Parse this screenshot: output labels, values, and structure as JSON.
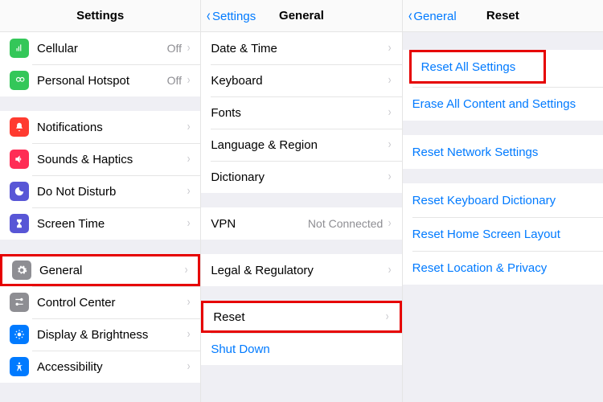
{
  "panes": {
    "settings": {
      "title": "Settings",
      "group1": [
        {
          "label": "Cellular",
          "detail": "Off",
          "icon": "antenna",
          "iconColor": "#34c759"
        },
        {
          "label": "Personal Hotspot",
          "detail": "Off",
          "icon": "link",
          "iconColor": "#34c759"
        }
      ],
      "group2": [
        {
          "label": "Notifications",
          "icon": "bell",
          "iconColor": "#ff3b30"
        },
        {
          "label": "Sounds & Haptics",
          "icon": "speaker",
          "iconColor": "#ff2d55"
        },
        {
          "label": "Do Not Disturb",
          "icon": "moon",
          "iconColor": "#5856d6"
        },
        {
          "label": "Screen Time",
          "icon": "hourglass",
          "iconColor": "#5856d6"
        }
      ],
      "group3": [
        {
          "label": "General",
          "icon": "gear",
          "iconColor": "#8e8e93",
          "highlight": true
        },
        {
          "label": "Control Center",
          "icon": "switches",
          "iconColor": "#8e8e93"
        },
        {
          "label": "Display & Brightness",
          "icon": "sun",
          "iconColor": "#007aff"
        },
        {
          "label": "Accessibility",
          "icon": "person",
          "iconColor": "#007aff"
        }
      ]
    },
    "general": {
      "back": "Settings",
      "title": "General",
      "group1": [
        {
          "label": "Date & Time"
        },
        {
          "label": "Keyboard"
        },
        {
          "label": "Fonts"
        },
        {
          "label": "Language & Region"
        },
        {
          "label": "Dictionary"
        }
      ],
      "group2": [
        {
          "label": "VPN",
          "detail": "Not Connected"
        }
      ],
      "group3": [
        {
          "label": "Legal & Regulatory"
        }
      ],
      "group4": [
        {
          "label": "Reset",
          "highlight": true
        },
        {
          "label": "Shut Down",
          "link": true,
          "noChevron": true
        }
      ]
    },
    "reset": {
      "back": "General",
      "title": "Reset",
      "group1": [
        {
          "label": "Reset All Settings",
          "highlight": true
        },
        {
          "label": "Erase All Content and Settings"
        }
      ],
      "group2": [
        {
          "label": "Reset Network Settings"
        }
      ],
      "group3": [
        {
          "label": "Reset Keyboard Dictionary"
        },
        {
          "label": "Reset Home Screen Layout"
        },
        {
          "label": "Reset Location & Privacy"
        }
      ]
    }
  }
}
